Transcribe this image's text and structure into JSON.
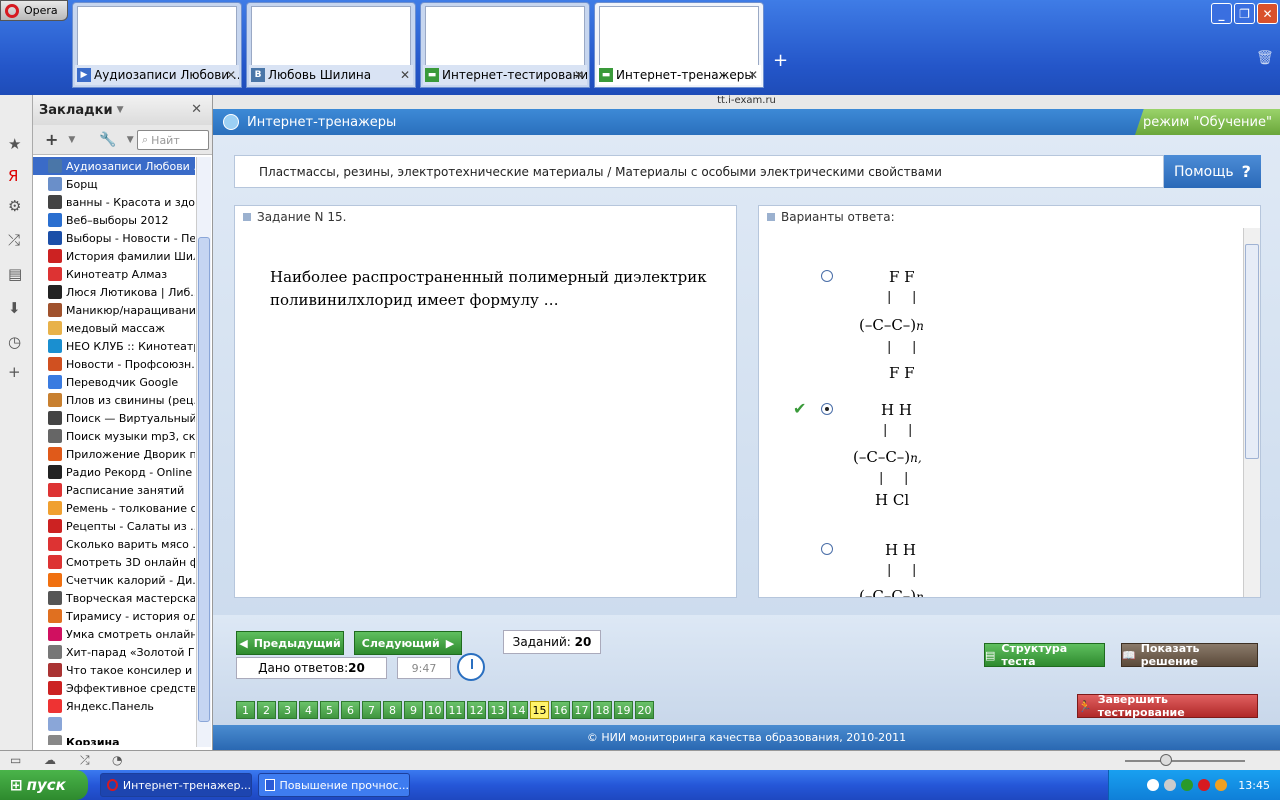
{
  "opera": {
    "label": "Opera"
  },
  "tabs": [
    {
      "label": "Аудиозаписи Любови ...",
      "icon": "play"
    },
    {
      "label": "Любовь Шилина",
      "icon": "vk"
    },
    {
      "label": "Интернет-тестирование",
      "icon": "green"
    },
    {
      "label": "Интернет-тренажеры",
      "icon": "green"
    }
  ],
  "bookmarks_panel": {
    "title": "Закладки",
    "search_placeholder": "Найт",
    "items": [
      "Аудиозаписи Любови ...",
      "Борщ",
      "ванны - Красота и здо...",
      "Веб–выборы 2012",
      "Выборы - Новости - Пе...",
      "История фамилии Шил...",
      "Кинотеатр Алмаз",
      "Люся Лютикова | Либ...",
      "Маникюр/наращивани...",
      "медовый массаж",
      "НЕО КЛУБ :: Кинотеатр",
      "Новости - Профсоюзн...",
      "Переводчик Google",
      "Плов из свинины (рец...",
      "Поиск — Виртуальный...",
      "Поиск музыки mp3, ск...",
      "Приложение Дворик п...",
      "Радио Рекорд - Online ...",
      "Расписание занятий",
      "Ремень - толкование с...",
      "Рецепты - Салаты из ...",
      "Сколько варить мясо ...",
      "Смотреть 3D онлайн ф...",
      "Счетчик калорий - Ди...",
      "Творческая мастерска...",
      "Тирамису - история од...",
      "Умка смотреть онлайн...",
      "Хит-парад «Золотой Г...",
      "Что такое консилер и ...",
      "Эффективное средств...",
      "Яндекс.Панель",
      "",
      "Корзина"
    ]
  },
  "address": "tt.i-exam.ru",
  "app": {
    "title": "Интернет-тренажеры",
    "mode": "режим \"Обучение\""
  },
  "breadcrumb": "Пластмассы, резины, электротехнические материалы / Материалы с особыми электрическими свойствами",
  "help_label": "Помощь",
  "question": {
    "title": "Задание N 15.",
    "text": "Наиболее распространенный полимерный диэлектрик поливинилхлорид имеет формулу …"
  },
  "answers": {
    "title": "Варианты ответа:",
    "options": [
      {
        "top": "F   F",
        "mid": "(–C–C–)",
        "sub": "n",
        "bottom": "F   F",
        "selected": false
      },
      {
        "top": "H   H",
        "mid": "(–C–C–)",
        "sub": "n,",
        "bottom": "H  Cl",
        "selected": true
      },
      {
        "top": "H   H",
        "mid": "(–C–C–)",
        "sub": "n",
        "bottom": "",
        "selected": false
      }
    ]
  },
  "nav": {
    "prev": "Предыдущий",
    "next": "Следующий",
    "tasks_label": "Заданий:",
    "tasks_count": "20",
    "answered_label": "Дано ответов:",
    "answered_count": "20",
    "timer": "9:47",
    "structure": "Структура теста",
    "solution": "Показать решение",
    "finish": "Завершить тестирование",
    "pages": [
      "1",
      "2",
      "3",
      "4",
      "5",
      "6",
      "7",
      "8",
      "9",
      "10",
      "11",
      "12",
      "13",
      "14",
      "15",
      "16",
      "17",
      "18",
      "19",
      "20"
    ],
    "current_page": "15"
  },
  "copyright": "© НИИ мониторинга качества образования, 2010-2011",
  "taskbar": {
    "start": "пуск",
    "tasks": [
      "Интернет-тренажер...",
      "Повышение прочнос..."
    ],
    "clock": "13:45"
  }
}
